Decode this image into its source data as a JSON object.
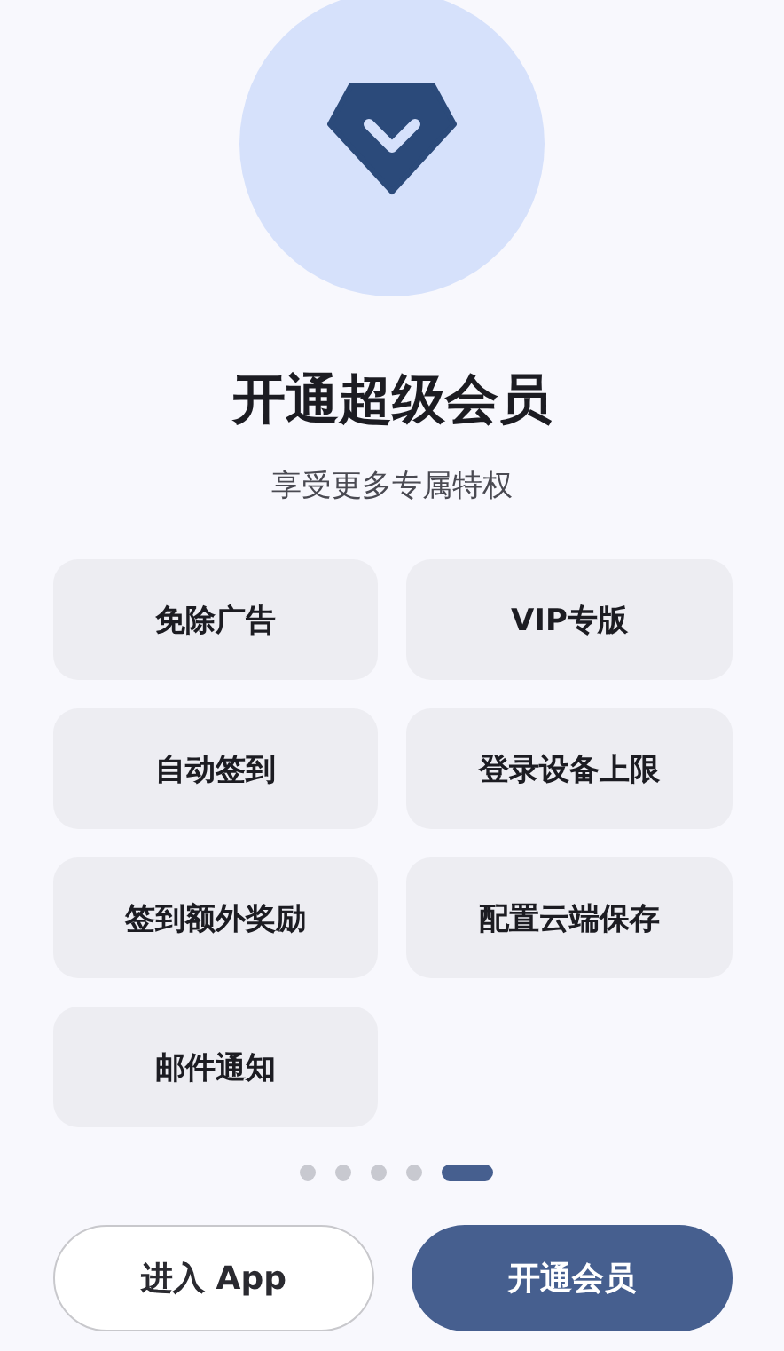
{
  "title": "开通超级会员",
  "subtitle": "享受更多专属特权",
  "benefits": [
    "免除广告",
    "VIP专版",
    "自动签到",
    "登录设备上限",
    "签到额外奖励",
    "配置云端保存",
    "邮件通知"
  ],
  "pages": [
    {
      "selected": false
    },
    {
      "selected": false
    },
    {
      "selected": false
    },
    {
      "selected": false
    },
    {
      "selected": true
    }
  ],
  "buttons": [
    {
      "label": "进入 App",
      "kind": "outline"
    },
    {
      "label": "开通会员",
      "kind": "primary"
    }
  ]
}
